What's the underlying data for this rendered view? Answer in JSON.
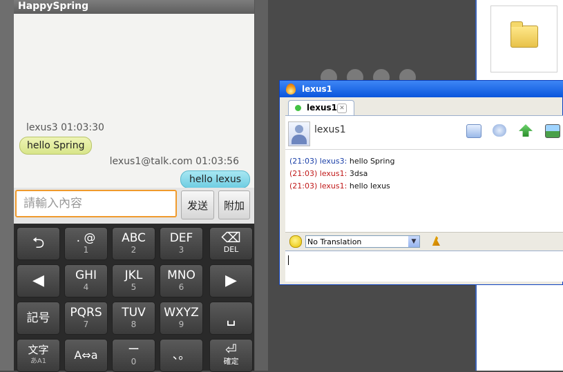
{
  "phone": {
    "app_title": "HappySpring",
    "chat": {
      "incoming": {
        "sender": "lexus3",
        "time": "01:03:30",
        "text": "hello Spring"
      },
      "outgoing": {
        "sender": "lexus1@talk.com",
        "time": "01:03:56",
        "text": "hello lexus"
      }
    },
    "input": {
      "placeholder": "請輸入內容",
      "send_label": "发送",
      "attach_label": "附加"
    },
    "keyboard": {
      "row1": [
        {
          "main": "⮌",
          "sub": ""
        },
        {
          "main": ". @",
          "sub": "1"
        },
        {
          "main": "ABC",
          "sub": "2"
        },
        {
          "main": "DEF",
          "sub": "3"
        },
        {
          "main": "⌫",
          "sub": "DEL"
        }
      ],
      "row2": [
        {
          "main": "◀",
          "sub": ""
        },
        {
          "main": "GHI",
          "sub": "4"
        },
        {
          "main": "JKL",
          "sub": "5"
        },
        {
          "main": "MNO",
          "sub": "6"
        },
        {
          "main": "▶",
          "sub": ""
        }
      ],
      "row3": [
        {
          "main": "記号",
          "sub": ""
        },
        {
          "main": "PQRS",
          "sub": "7"
        },
        {
          "main": "TUV",
          "sub": "8"
        },
        {
          "main": "WXYZ",
          "sub": "9"
        },
        {
          "main": "␣",
          "sub": ""
        }
      ],
      "row4": [
        {
          "main": "文字",
          "sub": "あA1"
        },
        {
          "main": "A⇔a",
          "sub": ""
        },
        {
          "main": "ー",
          "sub": "0"
        },
        {
          "main": "、。",
          "sub": ""
        },
        {
          "main": "⏎",
          "sub": "確定"
        }
      ]
    }
  },
  "im_window": {
    "title": "lexus1",
    "tab_label": "lexus1",
    "contact_name": "lexus1",
    "messages": [
      {
        "time": "(21:03)",
        "sender": "lexus3:",
        "text": "hello Spring",
        "color": "#1a3fa8"
      },
      {
        "time": "(21:03)",
        "sender": "lexus1:",
        "text": "3dsa",
        "color": "#c01818"
      },
      {
        "time": "(21:03)",
        "sender": "lexus1:",
        "text": "hello lexus",
        "color": "#c01818"
      }
    ],
    "translation_value": "No Translation"
  }
}
